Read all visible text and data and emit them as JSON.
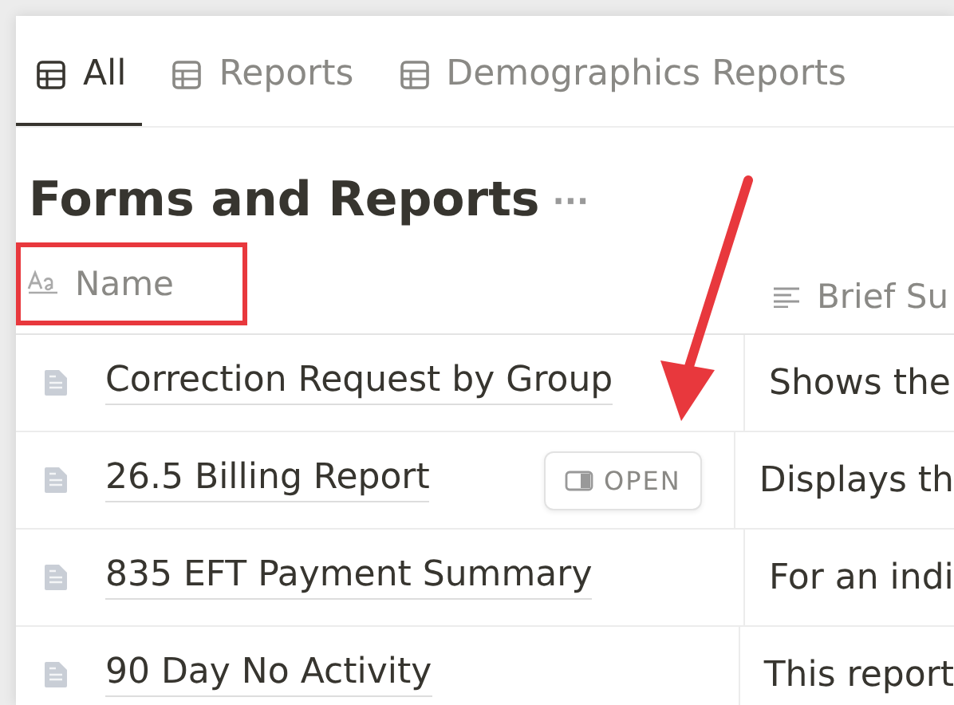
{
  "tabs": [
    {
      "label": "All",
      "selected": true
    },
    {
      "label": "Reports",
      "selected": false
    },
    {
      "label": "Demographics Reports",
      "selected": false
    }
  ],
  "title": "Forms and Reports",
  "more": "···",
  "columns": [
    {
      "kind": "title",
      "label": "Name",
      "highlighted": true
    },
    {
      "kind": "text",
      "label": "Brief Su",
      "highlighted": false
    }
  ],
  "rows": [
    {
      "name": "Correction Request by Group",
      "summary": "Shows the",
      "hovered": false
    },
    {
      "name": "26.5 Billing Report",
      "summary": "Displays th",
      "hovered": true,
      "open_label": "OPEN"
    },
    {
      "name": "835 EFT Payment Summary",
      "summary": "For an indi",
      "hovered": false
    },
    {
      "name": "90 Day No Activity",
      "summary": "This report",
      "hovered": false
    }
  ],
  "annotation_arrow": true
}
